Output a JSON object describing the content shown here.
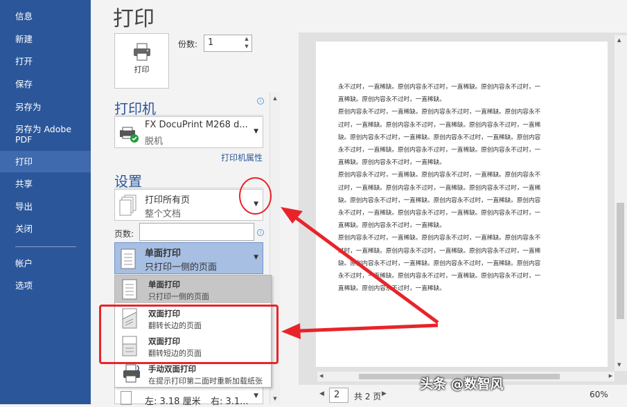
{
  "sidebar": {
    "items": [
      {
        "label": "信息"
      },
      {
        "label": "新建"
      },
      {
        "label": "打开"
      },
      {
        "label": "保存"
      },
      {
        "label": "另存为"
      },
      {
        "label": "另存为 Adobe PDF"
      },
      {
        "label": "打印"
      },
      {
        "label": "共享"
      },
      {
        "label": "导出"
      },
      {
        "label": "关闭"
      },
      {
        "label": "帐户"
      },
      {
        "label": "选项"
      }
    ],
    "active": "打印"
  },
  "page_title": "打印",
  "print_button": {
    "label": "打印"
  },
  "copies": {
    "label": "份数:",
    "value": "1"
  },
  "printer": {
    "heading": "打印机",
    "name": "FX DocuPrint M268 d...",
    "status": "脱机",
    "properties_link": "打印机属性"
  },
  "settings": {
    "heading": "设置",
    "range": {
      "title": "打印所有页",
      "subtitle": "整个文档"
    },
    "pages_label": "页数:",
    "duplex": {
      "title": "单面打印",
      "subtitle": "只打印一侧的页面"
    },
    "menu": [
      {
        "title": "单面打印",
        "subtitle": "只打印一侧的页面",
        "selected": true
      },
      {
        "title": "双面打印",
        "subtitle": "翻转长边的页面"
      },
      {
        "title": "双面打印",
        "subtitle": "翻转短边的页面"
      },
      {
        "title": "手动双面打印",
        "subtitle": "在提示打印第二面时重新加载纸张"
      }
    ],
    "margins": {
      "left": "左:  3.18 厘米",
      "right": "右:  3.1..."
    }
  },
  "preview": {
    "lines": [
      "永不过时，一直稀缺。原创内容永不过时，一直稀缺。原创内容永不过时，一",
      "直稀缺。原创内容永不过时，一直稀缺。",
      "原创内容永不过时，一直稀缺。原创内容永不过时，一直稀缺。原创内容永不",
      "过时，一直稀缺。原创内容永不过时，一直稀缺。原创内容永不过时，一直稀",
      "缺。原创内容永不过时，一直稀缺。原创内容永不过时，一直稀缺。原创内容",
      "永不过时，一直稀缺。原创内容永不过时，一直稀缺。原创内容永不过时，一",
      "直稀缺。原创内容永不过时，一直稀缺。",
      "原创内容永不过时，一直稀缺。原创内容永不过时，一直稀缺。原创内容永不",
      "过时，一直稀缺。原创内容永不过时，一直稀缺。原创内容永不过时，一直稀",
      "缺。原创内容永不过时，一直稀缺。原创内容永不过时，一直稀缺。原创内容",
      "永不过时，一直稀缺。原创内容永不过时，一直稀缺。原创内容永不过时，一",
      "直稀缺。原创内容永不过时，一直稀缺。",
      "原创内容永不过时，一直稀缺。原创内容永不过时，一直稀缺。原创内容永不",
      "过时，一直稀缺。原创内容永不过时，一直稀缺。原创内容永不过时，一直稀",
      "缺。原创内容永不过时，一直稀缺。原创内容永不过时，一直稀缺。原创内容",
      "永不过时，一直稀缺。原创内容永不过时，一直稀缺。原创内容永不过时，一",
      "直稀缺。原创内容永不过时，一直稀缺。"
    ]
  },
  "status_bar": {
    "page": "2",
    "total": "共 2 页",
    "zoom": "60%"
  },
  "watermark": "头条 @数智风",
  "colors": {
    "accent": "#2b579a",
    "annotation": "#e8242a"
  }
}
